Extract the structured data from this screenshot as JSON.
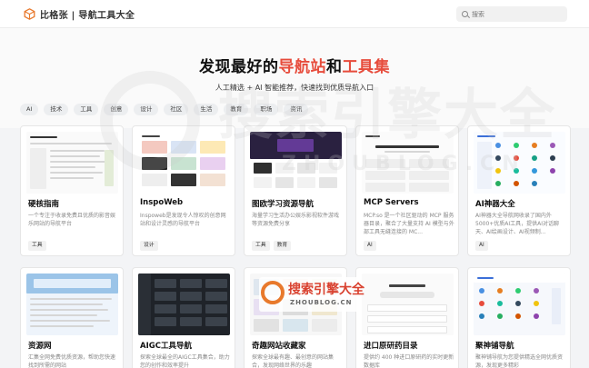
{
  "header": {
    "brand": "比格张 | 导航工具大全",
    "search_placeholder": "搜索"
  },
  "hero": {
    "title_part1": "发现最好的",
    "title_hl1": "导航站",
    "title_part2": "和",
    "title_hl2": "工具集",
    "subtitle": "人工精选 + AI 智能推荐，快速找到优质导航入口",
    "chips": [
      "AI",
      "技术",
      "工具",
      "创意",
      "设计",
      "社区",
      "生活",
      "教育",
      "职场",
      "资讯"
    ]
  },
  "watermark": {
    "text": "搜索引擎大全",
    "sub": "ZHOUBLOG.CN"
  },
  "cards": [
    {
      "title": "硬核指南",
      "desc": "一个专注于收录免费且优质的影音娱乐网站的导航平台",
      "tags": [
        "工具"
      ]
    },
    {
      "title": "InspoWeb",
      "desc": "Inspoweb是发现令人惊叹的创意网站和设计灵感的导航平台",
      "tags": [
        "设计"
      ]
    },
    {
      "title": "图欧学习资源导航",
      "desc": "海量学习生活办公娱乐影视软件游戏等资源免费分享",
      "tags": [
        "工具",
        "教育"
      ]
    },
    {
      "title": "MCP Servers",
      "desc": "MCP.so 是一个社区驱动的 MCP 服务器目录，聚合了大量支持 AI 模型与外部工具无缝连接的 MC...",
      "tags": [
        "AI"
      ]
    },
    {
      "title": "AI神器大全",
      "desc": "AI神器大全导航网收录了国内外5000+优质AI工具，提供AI对话聊天、AI绘画设计、AI视频制...",
      "tags": [
        "AI"
      ]
    },
    {
      "title": "资源网",
      "desc": "汇集全网免费优质资源，帮助您快速找到所需的网站",
      "tags": []
    },
    {
      "title": "AIGC工具导航",
      "desc": "探索全球最全的AIGC工具集合，助力您的创作和效率提升",
      "tags": []
    },
    {
      "title": "奇趣网站收藏家",
      "desc": "探索全球最有趣、最创意的网站集合，发现网络世界的乐趣",
      "tags": []
    },
    {
      "title": "进口原研药目录",
      "desc": "提供约 400 种进口原研药的实时更新数据库",
      "tags": []
    },
    {
      "title": "聚神铺导航",
      "desc": "聚神铺导航为您提供精选全网优质资源，发现更多精彩",
      "tags": []
    }
  ],
  "colors": {
    "accent": "#e74c3c",
    "brand_logo": "#e8792c"
  }
}
